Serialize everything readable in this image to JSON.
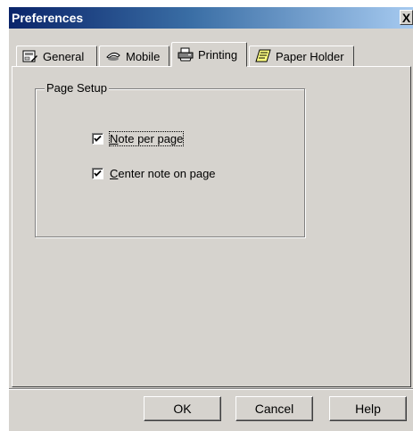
{
  "window": {
    "title": "Preferences",
    "close_glyph": "X"
  },
  "tabs": [
    {
      "label": "General",
      "icon": "general-settings-icon",
      "active": false
    },
    {
      "label": "Mobile",
      "icon": "mobile-icon",
      "active": false
    },
    {
      "label": "Printing",
      "icon": "printer-icon",
      "active": true
    },
    {
      "label": "Paper Holder",
      "icon": "paper-holder-icon",
      "active": false
    }
  ],
  "page_setup": {
    "group_label": "Page Setup",
    "note_per_page": {
      "label_mnemonic": "N",
      "label_rest": "ote per page",
      "checked": true
    },
    "center_note": {
      "label_mnemonic": "C",
      "label_rest": "enter note on page",
      "checked": true
    }
  },
  "buttons": {
    "ok": "OK",
    "cancel": "Cancel",
    "help": "Help"
  },
  "colors": {
    "face": "#d6d3ce",
    "title_start": "#0a246a",
    "title_end": "#a6caf0"
  }
}
